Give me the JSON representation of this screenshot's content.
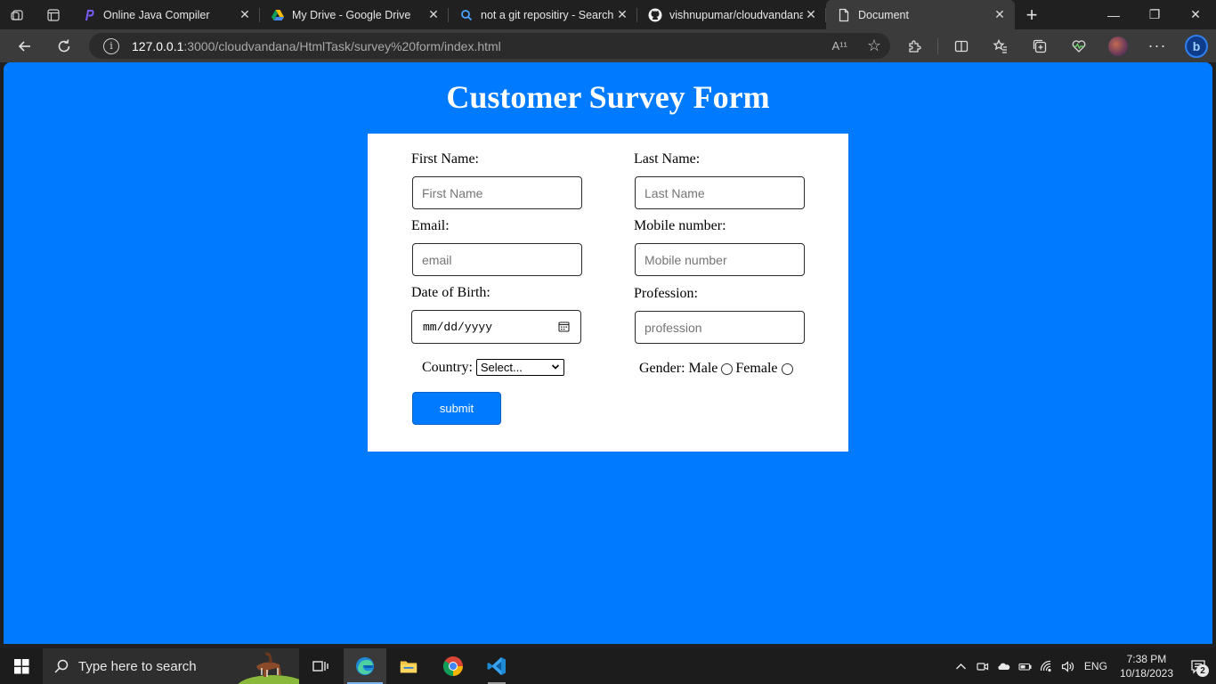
{
  "browser": {
    "tabs": [
      {
        "title": "Online Java Compiler",
        "icon": "programiz-icon",
        "active": false
      },
      {
        "title": "My Drive - Google Drive",
        "icon": "google-drive-icon",
        "active": false
      },
      {
        "title": "not a git repositiry - Search",
        "icon": "search-icon",
        "active": false
      },
      {
        "title": "vishnupumar/cloudvandana",
        "icon": "github-icon",
        "active": false
      },
      {
        "title": "Document",
        "icon": "document-icon",
        "active": true
      }
    ],
    "url_host": "127.0.0.1",
    "url_rest": ":3000/cloudvandana/HtmlTask/survey%20form/index.html",
    "read_aloud_label": "A¹¹"
  },
  "page": {
    "title": "Customer Survey Form",
    "background_color": "#007bff",
    "form": {
      "first_name_label": "First Name:",
      "first_name_placeholder": "First Name",
      "last_name_label": "Last Name:",
      "last_name_placeholder": "Last Name",
      "email_label": "Email:",
      "email_placeholder": "email",
      "mobile_label": "Mobile number:",
      "mobile_placeholder": "Mobile number",
      "dob_label": "Date of Birth:",
      "dob_placeholder": "mm/dd/yyyy",
      "profession_label": "Profession:",
      "profession_placeholder": "profession",
      "country_label": "Country:",
      "country_selected": "Select...",
      "gender_label": "Gender:",
      "gender_male": "Male",
      "gender_female": "Female",
      "submit_label": "submit"
    }
  },
  "taskbar": {
    "search_placeholder": "Type here to search",
    "language": "ENG",
    "time": "7:38 PM",
    "date": "10/18/2023",
    "notification_count": "2"
  }
}
